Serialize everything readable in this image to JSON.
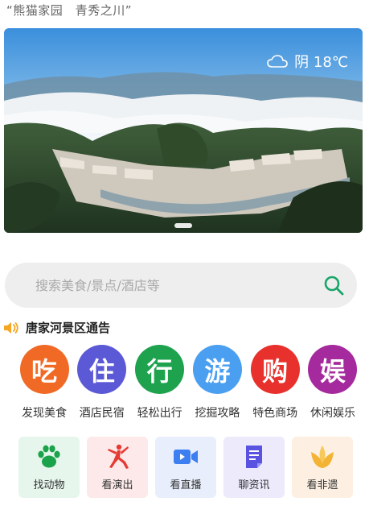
{
  "header": {
    "slogan": "“熊猫家园　青秀之川”"
  },
  "banner": {
    "weather_icon": "cloud-icon",
    "weather_text": "阴 18℃"
  },
  "search": {
    "placeholder": "搜索美食/景点/酒店等",
    "icon": "search-icon",
    "accent": "#1aa56a"
  },
  "notice": {
    "icon": "speaker-icon",
    "text": "唐家河景区通告"
  },
  "categories": [
    {
      "glyph": "吃",
      "label": "发现美食",
      "color": "#f06a26"
    },
    {
      "glyph": "住",
      "label": "酒店民宿",
      "color": "#5b59d6"
    },
    {
      "glyph": "行",
      "label": "轻松出行",
      "color": "#1ea24e"
    },
    {
      "glyph": "游",
      "label": "挖掘攻略",
      "color": "#4a9ff0"
    },
    {
      "glyph": "购",
      "label": "特色商场",
      "color": "#e8312c"
    },
    {
      "glyph": "娱",
      "label": "休闲娱乐",
      "color": "#a52a9d"
    }
  ],
  "tiles": [
    {
      "label": "找动物",
      "icon": "paw-icon",
      "bg": "#e6f6ec",
      "color": "#1aa34a"
    },
    {
      "label": "看演出",
      "icon": "dancer-icon",
      "bg": "#fde9e9",
      "color": "#e53935"
    },
    {
      "label": "看直播",
      "icon": "video-camera-icon",
      "bg": "#e8eefb",
      "color": "#3d7ff0"
    },
    {
      "label": "聊资讯",
      "icon": "document-icon",
      "bg": "#eceafb",
      "color": "#5a52e0"
    },
    {
      "label": "看非遗",
      "icon": "lotus-icon",
      "bg": "#fdf0e2",
      "color": "#f3b334"
    }
  ]
}
